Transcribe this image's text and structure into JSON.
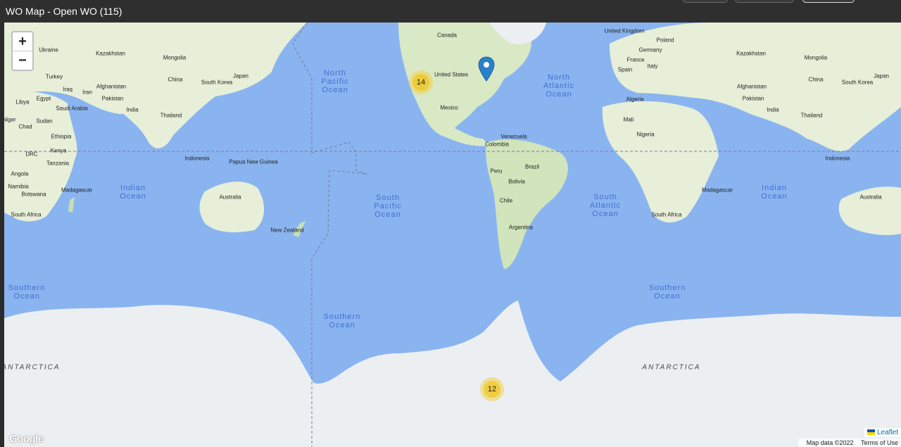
{
  "window": {
    "title": "WO Map - Open WO (115)"
  },
  "zoom": {
    "in_label": "+",
    "out_label": "−"
  },
  "clusters": [
    {
      "count": "14"
    },
    {
      "count": "12"
    }
  ],
  "countries": [
    "Canada",
    "United States",
    "Mexico",
    "Venezuela",
    "Colombia",
    "Peru",
    "Brazil",
    "Bolivia",
    "Chile",
    "Argentina",
    "Kazakhstan",
    "Mongolia",
    "China",
    "Japan",
    "South Korea",
    "Afghanistan",
    "Pakistan",
    "India",
    "Iran",
    "Iraq",
    "Turkey",
    "Ukraine",
    "Saudi Arabia",
    "Egypt",
    "Libya",
    "Sudan",
    "Chad",
    "Niger",
    "Ethiopia",
    "Kenya",
    "DRC",
    "Tanzania",
    "Angola",
    "Namibia",
    "Botswana",
    "Madagascar",
    "South Africa",
    "Thailand",
    "Indonesia",
    "Papua New Guinea",
    "Australia",
    "New Zealand",
    "United Kingdom",
    "Poland",
    "Germany",
    "France",
    "Spain",
    "Italy",
    "Algeria",
    "Mali",
    "Nigeria"
  ],
  "oceans": {
    "north_pacific": "North\nPacific\nOcean",
    "north_atlantic": "North\nAtlantic\nOcean",
    "south_pacific": "South\nPacific\nOcean",
    "south_atlantic": "South\nAtlantic\nOcean",
    "indian": "Indian\nOcean",
    "southern": "Southern\nOcean"
  },
  "antarctica": "ANTARCTICA",
  "attribution": {
    "leaflet": "Leaflet",
    "map_data": "Map data ©2022",
    "terms": "Terms of Use",
    "google": "Google"
  },
  "colors": {
    "water": "#8ab4f0",
    "land": "#e7efd8",
    "forest": "#c6dfb0",
    "ice": "#eceff2",
    "cluster": "#f1d357",
    "pin": "#2a81cb"
  }
}
